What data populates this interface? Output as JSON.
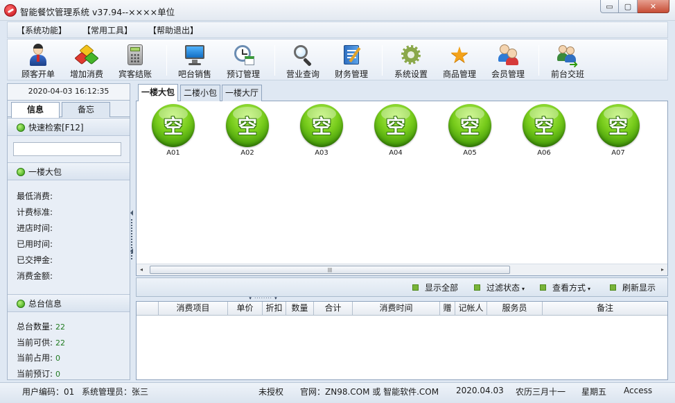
{
  "window": {
    "title": "智能餐饮管理系统 v37.94--××××单位",
    "min_glyph": "▭",
    "max_glyph": "▢",
    "close_glyph": "✕"
  },
  "menu": [
    "【系统功能】",
    "【常用工具】",
    "【帮助退出】"
  ],
  "toolbar": [
    {
      "label": "顾客开单",
      "icon": "customer-icon"
    },
    {
      "label": "增加消费",
      "icon": "cubes-icon"
    },
    {
      "label": "宾客结账",
      "icon": "calculator-icon"
    },
    {
      "label": "吧台销售",
      "icon": "monitor-icon"
    },
    {
      "label": "预订管理",
      "icon": "clock-calendar-icon"
    },
    {
      "label": "营业查询",
      "icon": "magnifier-icon"
    },
    {
      "label": "财务管理",
      "icon": "ledger-icon"
    },
    {
      "label": "系统设置",
      "icon": "gear-icon"
    },
    {
      "label": "商品管理",
      "icon": "star-icon"
    },
    {
      "label": "会员管理",
      "icon": "members-icon"
    },
    {
      "label": "前台交班",
      "icon": "shift-handover-icon"
    }
  ],
  "left": {
    "datetime": "2020-04-03 16:12:35",
    "tabs": [
      "信息",
      "备忘"
    ],
    "quick_search": "快速检索[F12]",
    "search_value": "",
    "area_title": "一楼大包",
    "info_rows": [
      "最低消费:",
      "计费标准:",
      "进店时间:",
      "已用时间:",
      "已交押金:",
      "消费金额:"
    ],
    "summary_title": "总台信息",
    "summary_rows": [
      {
        "label": "总台数量:",
        "value": "22"
      },
      {
        "label": "当前可供:",
        "value": "22"
      },
      {
        "label": "当前占用:",
        "value": "0"
      },
      {
        "label": "当前预订:",
        "value": "0"
      }
    ]
  },
  "room_tabs": [
    "一楼大包",
    "二楼小包",
    "一楼大厅"
  ],
  "rooms": [
    {
      "status": "空",
      "name": "A01"
    },
    {
      "status": "空",
      "name": "A02"
    },
    {
      "status": "空",
      "name": "A03"
    },
    {
      "status": "空",
      "name": "A04"
    },
    {
      "status": "空",
      "name": "A05"
    },
    {
      "status": "空",
      "name": "A06"
    },
    {
      "status": "空",
      "name": "A07"
    }
  ],
  "scroll": {
    "left": "◂",
    "right": "▸",
    "grip": "ǀǀǀ"
  },
  "actions": {
    "show_all": "显示全部",
    "filter": "过滤状态",
    "view": "查看方式",
    "refresh": "刷新显示",
    "caret": "▾"
  },
  "splitter_grip": "▾ ········ ▾",
  "detail_columns": [
    "消费项目",
    "单价",
    "折扣",
    "数量",
    "合计",
    "消费时间",
    "赠",
    "记帐人",
    "服务员",
    "备注"
  ],
  "status": {
    "user_code": "用户编码：01",
    "operator": "系统管理员：张三",
    "license": "未授权",
    "website": "官网：ZN98.COM 或 智能软件.COM",
    "date": "2020.04.03",
    "lunar": "农历三月十一",
    "weekday": "星期五",
    "db": "Access"
  },
  "colors": {
    "room_free": "#6fc21a",
    "accent": "#2f6fc1"
  }
}
